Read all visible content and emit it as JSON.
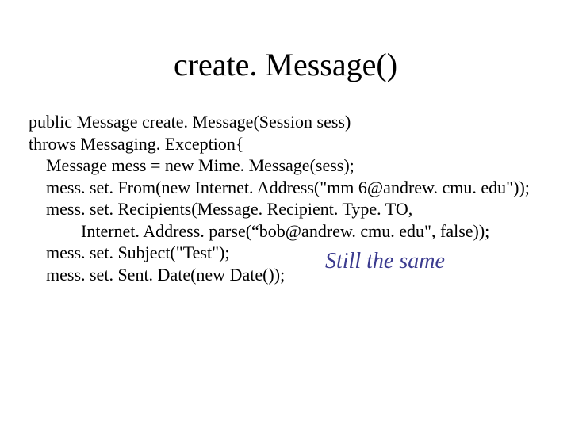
{
  "title": "create. Message()",
  "code": {
    "l1": "public Message create. Message(Session sess)",
    "l2": "throws Messaging. Exception{",
    "l3": "    Message mess = new Mime. Message(sess);",
    "l4": "    mess. set. From(new Internet. Address(\"mm 6@andrew. cmu. edu\"));",
    "l5": "    mess. set. Recipients(Message. Recipient. Type. TO,",
    "l6": "            Internet. Address. parse(“bob@andrew. cmu. edu\", false));",
    "l7": "    mess. set. Subject(\"Test\");",
    "l8": "    mess. set. Sent. Date(new Date());"
  },
  "annotation": "Still the same"
}
